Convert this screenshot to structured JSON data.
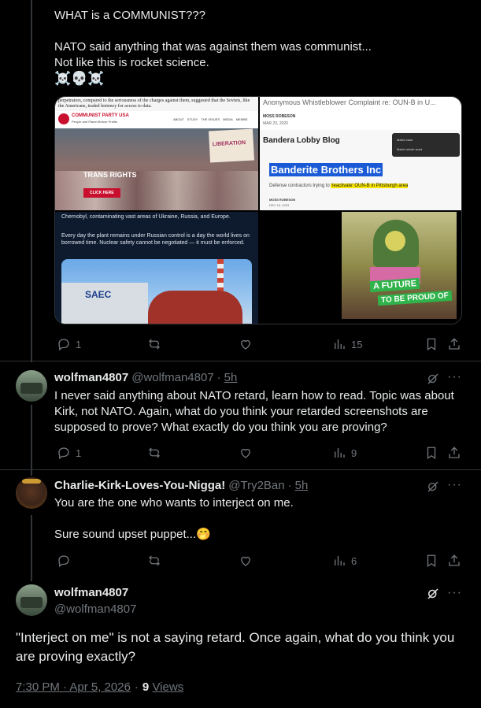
{
  "post1": {
    "text": "WHAT is a COMMUNIST???\n\nNATO said anything that was against them was communist...\nNot like this is rocket science.",
    "emoji": "☠️💀☠️",
    "replies": "1",
    "views": "15",
    "images": {
      "img1": {
        "top_caption": "perpetrators, compared to the seriousness of the charges against them, suggested that the Soviets, like the Americans, traded leniency for access to data.",
        "org": "COMMUNIST PARTY USA",
        "org_sub": "People and Planet Before Profits",
        "nav": [
          "ABOUT",
          "STUDY",
          "THE ISSUES",
          "MEDIA",
          "MEMBE"
        ],
        "banner": "TRANS RIGHTS",
        "button": "CLICK HERE",
        "sign": "LIBERATION"
      },
      "img2": {
        "title": "Anonymous Whistleblower Complaint re: OUN-B in U...",
        "author": "MOSS ROBESON",
        "date": "MAR 23, 2020",
        "blog": "Bandera Lobby Blog",
        "headline": "Banderite Brothers Inc",
        "sub_before": "Defense contractors trying to ",
        "sub_highlight": "'reactivate' OUN-B in Pittsburgh area",
        "author2": "MOSS ROBESON",
        "date2": "DEC 16, 2023",
        "menu": [
          "Match case",
          "Match whole word"
        ]
      },
      "img3": {
        "text_top": "Chernobyl, contaminating vast areas of Ukraine, Russia, and Europe.",
        "text_mid": "Every day the plant remains under Russian control is a day the world lives on borrowed time. Nuclear safety cannot be negotiated — it must be enforced.",
        "building_sign": "SAEC"
      },
      "img4": {
        "line1": "A FUTURE",
        "line2": "TO BE PROUD OF"
      }
    }
  },
  "reply1": {
    "name": "wolfman4807",
    "handle": "@wolfman4807",
    "dot": "·",
    "time": "5h",
    "text": "I never said anything about NATO retard, learn how to read. Topic was about Kirk, not NATO. Again, what do you think your retarded screenshots are supposed to prove? What exactly do you think you are proving?",
    "replies": "1",
    "views": "9"
  },
  "reply2": {
    "name": "Charlie-Kirk-Loves-You-Nigga!",
    "handle": "@Try2Ban",
    "dot": "·",
    "time": "5h",
    "text": "You are the one who wants to interject on me.\n\nSure sound upset puppet...",
    "emoji": "🤭",
    "views": "6"
  },
  "main": {
    "name": "wolfman4807",
    "handle": "@wolfman4807",
    "text": "\"Interject on me\" is not a saying retard. Once again, what do you think you are proving exactly?",
    "timestamp": "7:30 PM · Apr 5, 2026",
    "dot": "·",
    "views_count": "9",
    "views_label": "Views"
  },
  "icons": {
    "more": "more-icon",
    "grok": "grok-icon",
    "reply": "reply-icon",
    "retweet": "retweet-icon",
    "like": "like-icon",
    "views": "views-icon",
    "bookmark": "bookmark-icon",
    "share": "share-icon"
  },
  "colors": {
    "background": "#000000",
    "text": "#e7e9ea",
    "muted": "#71767b",
    "border": "#2f3336"
  }
}
